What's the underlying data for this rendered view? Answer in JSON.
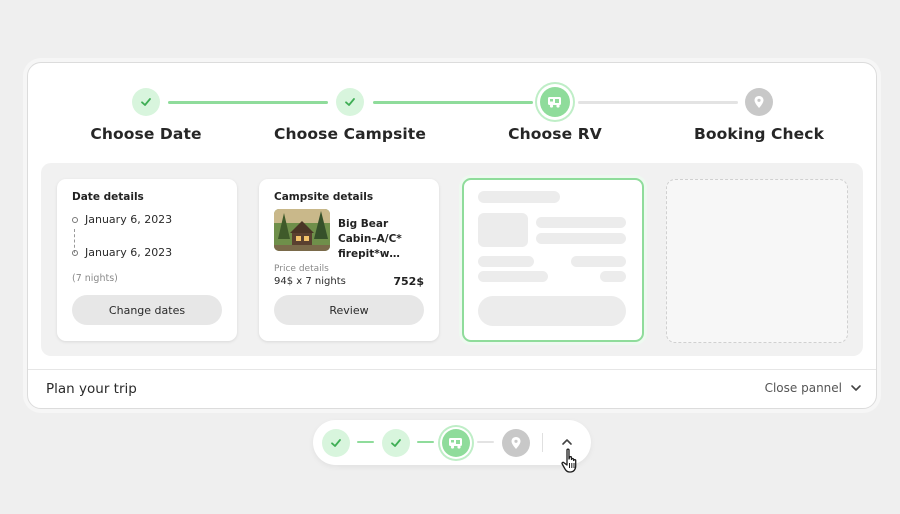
{
  "stepper": {
    "steps": [
      {
        "label": "Choose Date",
        "state": "done",
        "icon": "check-icon"
      },
      {
        "label": "Choose Campsite",
        "state": "done",
        "icon": "check-icon"
      },
      {
        "label": "Choose RV",
        "state": "active",
        "icon": "rv-icon"
      },
      {
        "label": "Booking Check",
        "state": "pending",
        "icon": "location-pin-icon"
      }
    ]
  },
  "date_card": {
    "title": "Date details",
    "start_date": "January 6, 2023",
    "end_date": "January 6, 2023",
    "nights": "(7 nights)",
    "button_label": "Change dates"
  },
  "campsite_card": {
    "title": "Campsite details",
    "name": "Big Bear Cabin–A/C* firepit*w…",
    "price_label": "Price details",
    "price_calc": "94$ x 7 nights",
    "price_total": "752$",
    "button_label": "Review",
    "thumbnail": "cabin-photo"
  },
  "footer": {
    "title": "Plan your trip",
    "close_label": "Close pannel",
    "close_icon": "chevron-down-icon"
  },
  "mini_bar": {
    "toggle_icon": "chevron-up-icon",
    "cursor_icon": "hand-pointer-icon"
  },
  "colors": {
    "done_fill": "#d8f5dd",
    "active_fill": "#8fdc9b",
    "check_green": "#3fae55",
    "pending_fill": "#c8c8c8",
    "line_done": "#8fdc9b",
    "line_todo": "#e3e3e3"
  }
}
